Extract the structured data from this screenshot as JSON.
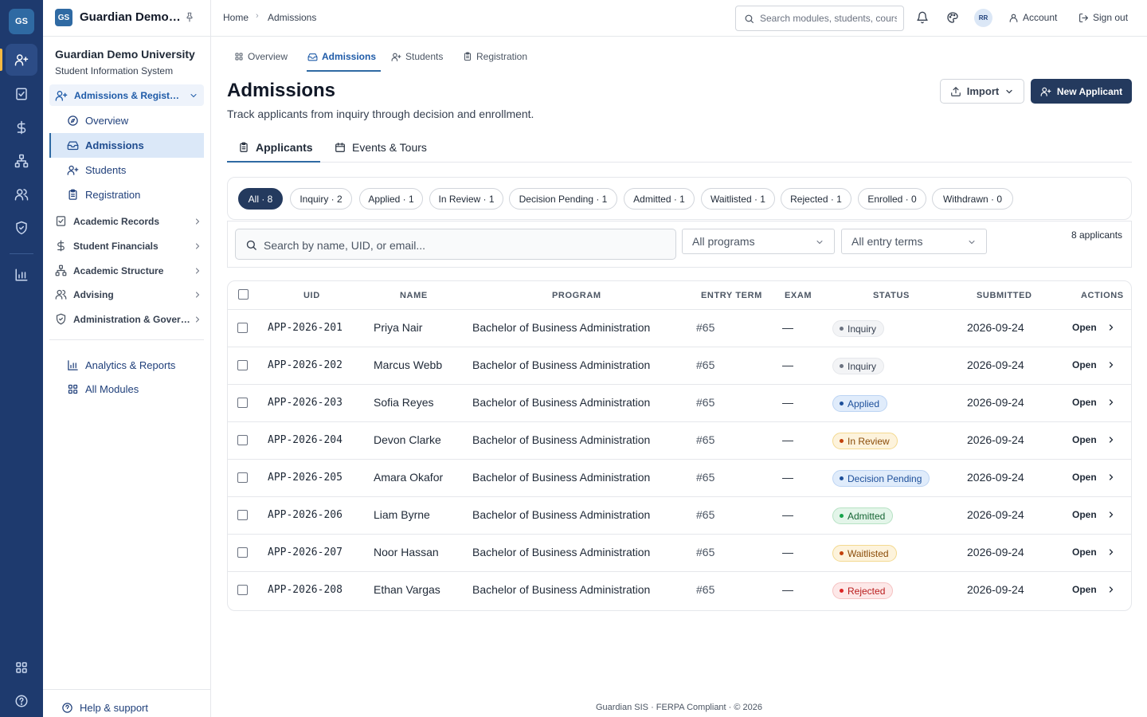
{
  "rail": {
    "logo": "GS"
  },
  "sidebar": {
    "logo": "GS",
    "app_name": "Guardian Demo University",
    "university": "Guardian Demo University",
    "system": "Student Information System",
    "active_group": "Admissions & Registration",
    "sub_items": [
      "Overview",
      "Admissions",
      "Students",
      "Registration"
    ],
    "groups": [
      "Academic Records",
      "Student Financials",
      "Academic Structure",
      "Advising",
      "Administration & Governance"
    ],
    "bottom_links": [
      "Analytics & Reports",
      "All Modules"
    ],
    "help": "Help & support"
  },
  "topbar": {
    "breadcrumb_home": "Home",
    "breadcrumb_current": "Admissions",
    "search_placeholder": "Search modules, students, courses...",
    "avatar": "RR",
    "account": "Account",
    "sign_out": "Sign out"
  },
  "module_tabs": [
    "Overview",
    "Admissions",
    "Students",
    "Registration"
  ],
  "header": {
    "title": "Admissions",
    "subtitle": "Track applicants from inquiry through decision and enrollment.",
    "import_label": "Import",
    "new_label": "New Applicant"
  },
  "sub_tabs": [
    "Applicants",
    "Events & Tours"
  ],
  "filters": {
    "chips": [
      {
        "label": "All · 8",
        "active": true
      },
      {
        "label": "Inquiry · 2",
        "active": false
      },
      {
        "label": "Applied · 1",
        "active": false
      },
      {
        "label": "In Review · 1",
        "active": false
      },
      {
        "label": "Decision Pending · 1",
        "active": false
      },
      {
        "label": "Admitted · 1",
        "active": false
      },
      {
        "label": "Waitlisted · 1",
        "active": false
      },
      {
        "label": "Rejected · 1",
        "active": false
      },
      {
        "label": "Enrolled · 0",
        "active": false
      },
      {
        "label": "Withdrawn · 0",
        "active": false
      }
    ],
    "search_placeholder": "Search by name, UID, or email...",
    "program_select": "All programs",
    "term_select": "All entry terms",
    "count": "8 applicants"
  },
  "table": {
    "headers": [
      "UID",
      "NAME",
      "PROGRAM",
      "ENTRY TERM",
      "EXAM",
      "STATUS",
      "SUBMITTED",
      "ACTIONS"
    ],
    "rows": [
      {
        "uid": "APP-2026-201",
        "name": "Priya Nair",
        "program": "Bachelor of Business Administration",
        "term": "#65",
        "exam": "—",
        "status": "Inquiry",
        "submitted": "2026-09-24",
        "action": "Open"
      },
      {
        "uid": "APP-2026-202",
        "name": "Marcus Webb",
        "program": "Bachelor of Business Administration",
        "term": "#65",
        "exam": "—",
        "status": "Inquiry",
        "submitted": "2026-09-24",
        "action": "Open"
      },
      {
        "uid": "APP-2026-203",
        "name": "Sofia Reyes",
        "program": "Bachelor of Business Administration",
        "term": "#65",
        "exam": "—",
        "status": "Applied",
        "submitted": "2026-09-24",
        "action": "Open"
      },
      {
        "uid": "APP-2026-204",
        "name": "Devon Clarke",
        "program": "Bachelor of Business Administration",
        "term": "#65",
        "exam": "—",
        "status": "In Review",
        "submitted": "2026-09-24",
        "action": "Open"
      },
      {
        "uid": "APP-2026-205",
        "name": "Amara Okafor",
        "program": "Bachelor of Business Administration",
        "term": "#65",
        "exam": "—",
        "status": "Decision Pending",
        "submitted": "2026-09-24",
        "action": "Open"
      },
      {
        "uid": "APP-2026-206",
        "name": "Liam Byrne",
        "program": "Bachelor of Business Administration",
        "term": "#65",
        "exam": "—",
        "status": "Admitted",
        "submitted": "2026-09-24",
        "action": "Open"
      },
      {
        "uid": "APP-2026-207",
        "name": "Noor Hassan",
        "program": "Bachelor of Business Administration",
        "term": "#65",
        "exam": "—",
        "status": "Waitlisted",
        "submitted": "2026-09-24",
        "action": "Open"
      },
      {
        "uid": "APP-2026-208",
        "name": "Ethan Vargas",
        "program": "Bachelor of Business Administration",
        "term": "#65",
        "exam": "—",
        "status": "Rejected",
        "submitted": "2026-09-24",
        "action": "Open"
      }
    ]
  },
  "status_colors": {
    "Inquiry": {
      "bg": "#f3f4f6",
      "border": "#e5e7eb",
      "text": "#374151",
      "dot": "#6b7280"
    },
    "Applied": {
      "bg": "#e0ecfb",
      "border": "#bcd4f3",
      "text": "#1d4f9a",
      "dot": "#1d4f9a"
    },
    "In Review": {
      "bg": "#fdf3dc",
      "border": "#f3d98f",
      "text": "#8a4b08",
      "dot": "#c2410c"
    },
    "Decision Pending": {
      "bg": "#e0ecfb",
      "border": "#bcd4f3",
      "text": "#1d4f9a",
      "dot": "#1d4f9a"
    },
    "Admitted": {
      "bg": "#e3f5e9",
      "border": "#b7e2c4",
      "text": "#166534",
      "dot": "#16a34a"
    },
    "Waitlisted": {
      "bg": "#fdf3dc",
      "border": "#f3d98f",
      "text": "#8a4b08",
      "dot": "#c2410c"
    },
    "Rejected": {
      "bg": "#fde8e8",
      "border": "#f5c2c2",
      "text": "#b91c1c",
      "dot": "#dc2626"
    }
  },
  "footer": "Guardian SIS · FERPA Compliant · © 2026"
}
